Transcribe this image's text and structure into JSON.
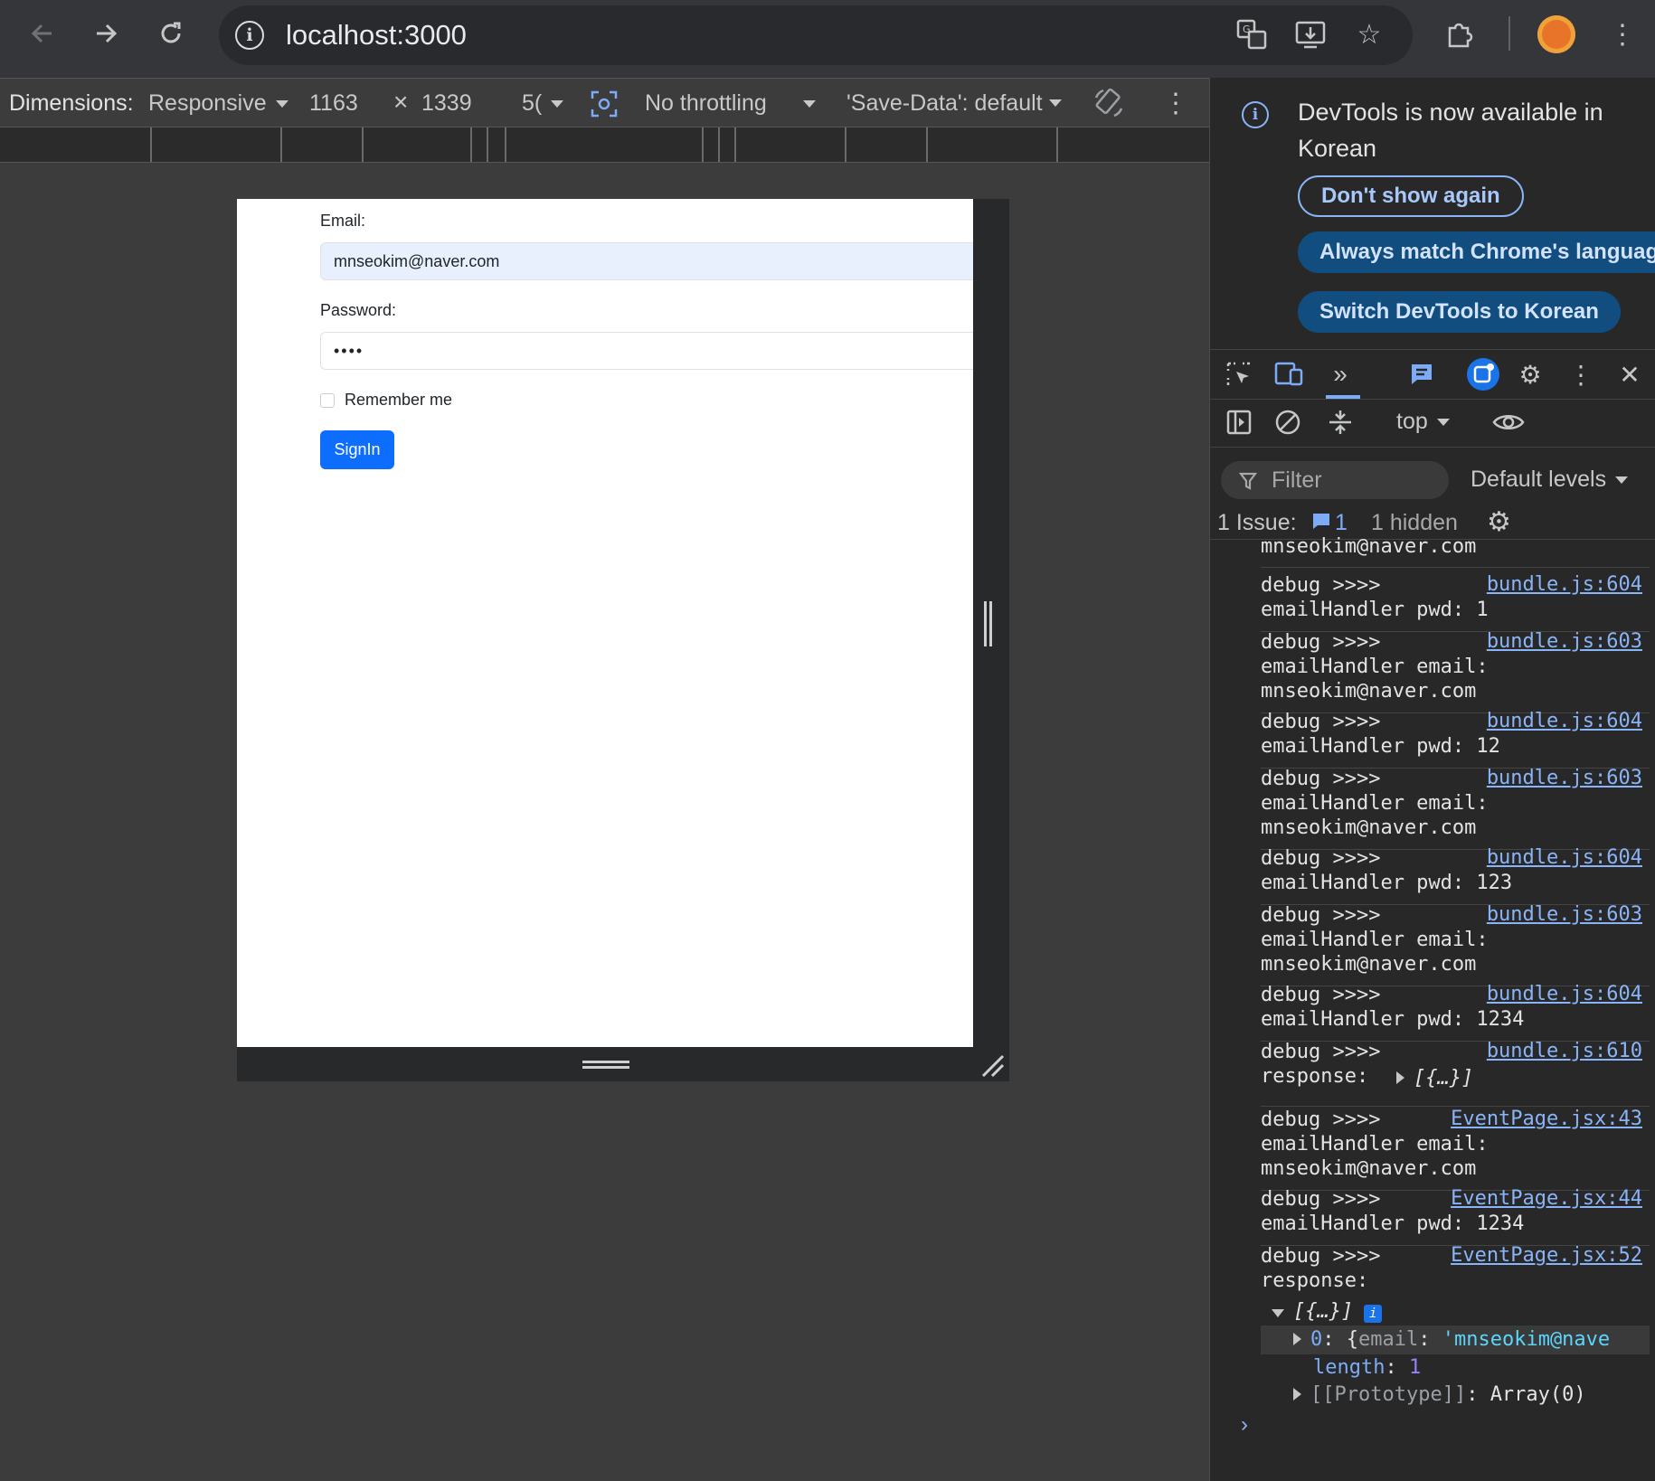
{
  "browser": {
    "url": "localhost:3000"
  },
  "device_toolbar": {
    "dimensions_label": "Dimensions:",
    "device": "Responsive",
    "width": "1163",
    "times": "×",
    "height": "1339",
    "zoom": "5(",
    "throttling": "No throttling",
    "save_data": "'Save-Data': default"
  },
  "page": {
    "email_label": "Email:",
    "email_value": "mnseokim@naver.com",
    "password_label": "Password:",
    "password_value": "••••",
    "remember_label": "Remember me",
    "signin_label": "SignIn"
  },
  "devtools": {
    "notice": "DevTools is now available in Korean",
    "dont_show": "Don't show again",
    "always_match": "Always match Chrome's languag",
    "switch_korean": "Switch DevTools to Korean",
    "context": "top",
    "filter_placeholder": "Filter",
    "levels": "Default levels",
    "issues_label": "1 Issue:",
    "issues_count": "1",
    "hidden": "1 hidden",
    "console_first_line": "mnseokim@naver.com",
    "entries": [
      {
        "src": "bundle.js:604",
        "lines": [
          "debug >>>>",
          "emailHandler pwd: 1"
        ]
      },
      {
        "src": "bundle.js:603",
        "lines": [
          "debug >>>>",
          "emailHandler email:",
          "mnseokim@naver.com"
        ]
      },
      {
        "src": "bundle.js:604",
        "lines": [
          "debug >>>>",
          "emailHandler pwd: 12"
        ]
      },
      {
        "src": "bundle.js:603",
        "lines": [
          "debug >>>>",
          "emailHandler email:",
          "mnseokim@naver.com"
        ]
      },
      {
        "src": "bundle.js:604",
        "lines": [
          "debug >>>>",
          "emailHandler pwd: 123"
        ]
      },
      {
        "src": "bundle.js:603",
        "lines": [
          "debug >>>>",
          "emailHandler email:",
          "mnseokim@naver.com"
        ]
      },
      {
        "src": "bundle.js:604",
        "lines": [
          "debug >>>>",
          "emailHandler pwd: 1234"
        ]
      },
      {
        "src": "bundle.js:610",
        "lines": [
          "debug >>>>",
          "response:"
        ]
      },
      {
        "src": "EventPage.jsx:43",
        "lines": [
          "debug >>>>",
          "emailHandler email:",
          "mnseokim@naver.com"
        ]
      },
      {
        "src": "EventPage.jsx:44",
        "lines": [
          "debug >>>>",
          "emailHandler pwd: 1234"
        ]
      },
      {
        "src": "EventPage.jsx:52",
        "lines": [
          "debug >>>>",
          "response:"
        ]
      }
    ],
    "collapsed_array": "[{…}]",
    "expanded_array": "[{…}]",
    "item0_key": "0",
    "item0_prop": "email",
    "item0_val": "'mnseokim@nave",
    "length_key": "length",
    "length_val": "1",
    "prototype_key": "[[Prototype]]",
    "prototype_val": "Array(0)"
  }
}
